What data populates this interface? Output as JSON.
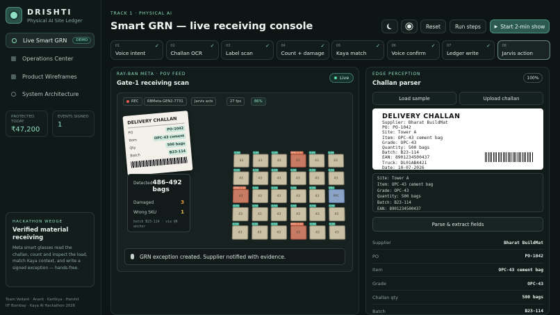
{
  "brand": {
    "name": "DRISHTI",
    "subtitle": "Physical AI Site Ledger"
  },
  "sidebar": {
    "items": [
      {
        "label": "Live Smart GRN",
        "badge": "DEMO",
        "active": true
      },
      {
        "label": "Operations Center"
      },
      {
        "label": "Product Wireframes"
      },
      {
        "label": "System Architecture"
      }
    ],
    "stats": [
      {
        "label": "PROTECTED TODAY",
        "value": "₹47,200"
      },
      {
        "label": "EVENTS SIGNED",
        "value": "1"
      }
    ],
    "wedge": {
      "tag": "HACKATHON WEDGE",
      "heading": "Verified material receiving",
      "body": "Meta smart glasses read the challan, count and inspect the load, match Kaya context, and write a signed exception — hands-free."
    },
    "team_line1": "Team Vedant · Anant · Kartikya · Harshit",
    "team_line2": "IIT Bombay · Kaya AI Hackathon 2026"
  },
  "header": {
    "track": "TRACK 1 · PHYSICAL AI",
    "title": "Smart GRN — live receiving console",
    "reset": "Reset",
    "run_steps": "Run steps",
    "start_show": "Start 2-min show"
  },
  "steps": [
    {
      "num": "01",
      "label": "Voice intent",
      "done": true
    },
    {
      "num": "02",
      "label": "Challan OCR",
      "done": true
    },
    {
      "num": "03",
      "label": "Label scan",
      "done": true
    },
    {
      "num": "04",
      "label": "Count + damage",
      "done": true
    },
    {
      "num": "05",
      "label": "Kaya match",
      "done": true
    },
    {
      "num": "06",
      "label": "Voice confirm",
      "done": true
    },
    {
      "num": "07",
      "label": "Ledger write",
      "done": true
    },
    {
      "num": "08",
      "label": "Jarvis action",
      "done": false
    }
  ],
  "pov": {
    "label": "RAY-BAN META · POV FEED",
    "title": "Gate-1 receiving scan",
    "live": "Live",
    "hud": {
      "rec": "REC",
      "device": "RBMeta-GEN2-7731",
      "mode": "Jarvis acts",
      "fps": "27 fps",
      "pct": "86%"
    },
    "card": {
      "title": "DELIVERY CHALLAN",
      "rows": [
        {
          "k": "PO",
          "v": "PO-1042"
        },
        {
          "k": "Item",
          "v": "OPC-43 cement"
        },
        {
          "k": "Qty",
          "v": "500 bags"
        },
        {
          "k": "Batch",
          "v": "B23-114"
        }
      ]
    },
    "detect": {
      "detected_label": "Detected",
      "detected_value": "486–492 bags",
      "damaged_label": "Damaged",
      "damaged_value": "3",
      "wrong_label": "Wrong SKU",
      "wrong_value": "1",
      "note": "batch B23-114 · via QR anchor"
    },
    "toast": "GRN exception created. Supplier notified with evidence."
  },
  "edge": {
    "label": "EDGE PERCEPTION",
    "title": "Challan parser",
    "pct": "100%",
    "load_sample": "Load sample",
    "upload": "Upload challan",
    "doc_title": "DELIVERY CHALLAN",
    "doc_lines": [
      "Supplier: Bharat BuildMat",
      "PO: PO-1042",
      "Site: Tower A",
      "Item: OPC-43 cement bag",
      "Grade: OPC-43",
      "Quantity: 500 bags",
      "Batch: B23-114",
      "EAN: 8901234500437",
      "Truck: DL01AB4421",
      "Date: 10-07-2026"
    ],
    "ocr_lines": [
      "Site: Tower A",
      "Item: OPC-43 cement bag",
      "Grade: OPC-43",
      "Quantity: 500 bags",
      "Batch: B23-114",
      "EAN: 8901234500437"
    ],
    "parse": "Parse & extract fields",
    "fields": [
      {
        "k": "Supplier",
        "v": "Bharat BuildMat"
      },
      {
        "k": "PO",
        "v": "PO-1042"
      },
      {
        "k": "Item",
        "v": "OPC-43 cement bag"
      },
      {
        "k": "Grade",
        "v": "OPC-43"
      },
      {
        "k": "Challan qty",
        "v": "500 bags"
      },
      {
        "k": "Batch",
        "v": "B23-114"
      }
    ]
  },
  "grid": {
    "box_label": "43",
    "tag_ok": "0.94",
    "tag_damaged": "DMG 0.91",
    "tag_sku": "SKU",
    "blue_label": "PPC",
    "damaged_cells": [
      3,
      12,
      27,
      37
    ],
    "blue_cells": [
      17
    ],
    "sku_tag_cell": 17
  },
  "colors": {
    "accent": "#8fe0c4",
    "background": "#0d1614",
    "danger": "#e06a4a",
    "warning": "#f0a340"
  }
}
